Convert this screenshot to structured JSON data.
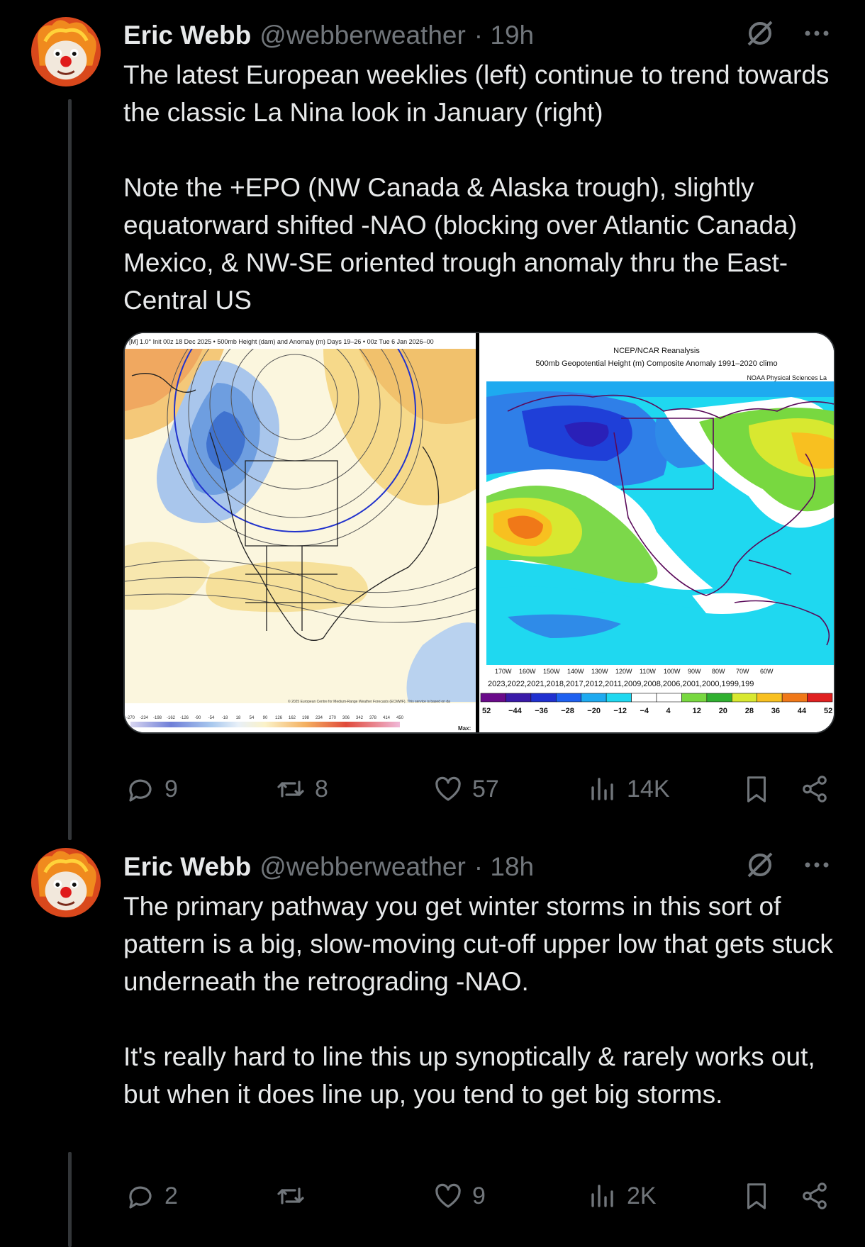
{
  "tweets": [
    {
      "author_name": "Eric Webb",
      "author_handle": "@webberweather",
      "time": "· 19h",
      "text": "The latest European weeklies (left) continue to trend towards the classic La Nina look in January (right)\n\nNote the +EPO (NW Canada & Alaska trough), slightly equatorward shifted -NAO (blocking over Atlantic Canada) Mexico, & NW-SE oriented trough anomaly thru the East-Central US",
      "actions": {
        "replies": "9",
        "reposts": "8",
        "likes": "57",
        "views": "14K"
      }
    },
    {
      "author_name": "Eric Webb",
      "author_handle": "@webberweather",
      "time": "· 18h",
      "text": "The primary pathway you get winter storms in this sort of pattern is a big, slow-moving cut-off upper low that gets stuck underneath the retrograding -NAO.\n\nIt's really hard to line this up synoptically & rarely works out, but when it does line up, you tend to get big storms.",
      "actions": {
        "replies": "2",
        "reposts": "",
        "likes": "9",
        "views": "2K"
      }
    }
  ],
  "media": {
    "left_map": {
      "header": "[M] 1.0° Init 00z 18 Dec 2025 • 500mb Height (dam) and Anomaly (m) Days 19–26 • 00z Tue 6 Jan 2026–00",
      "copyright": "© 2025 European Centre for Medium-Range Weather Forecasts (ECMWF). This service is based on da",
      "scale_labels": [
        "-270",
        "-234",
        "-198",
        "-162",
        "-126",
        "-90",
        "-54",
        "-18",
        "18",
        "54",
        "90",
        "126",
        "162",
        "198",
        "234",
        "270",
        "306",
        "342",
        "378",
        "414",
        "450"
      ],
      "max_label": "Max:"
    },
    "right_map": {
      "title_line1": "NCEP/NCAR Reanalysis",
      "title_line2": "500mb Geopotential Height (m) Composite Anomaly 1991–2020 climo",
      "credit": "NOAA Physical Sciences La",
      "lon_labels": [
        "170W",
        "160W",
        "150W",
        "140W",
        "130W",
        "120W",
        "110W",
        "100W",
        "90W",
        "80W",
        "70W",
        "60W"
      ],
      "years": "2023,2022,2021,2018,2017,2012,2011,2009,2008,2006,2001,2000,1999,199",
      "scale_labels": [
        "52",
        "−44",
        "−36",
        "−28",
        "−20",
        "−12",
        "−4",
        "4",
        "12",
        "20",
        "28",
        "36",
        "44",
        "52"
      ]
    }
  },
  "colors": {
    "background": "#000000",
    "text": "#e7e9ea",
    "muted": "#71767b",
    "border": "#2f3336"
  }
}
